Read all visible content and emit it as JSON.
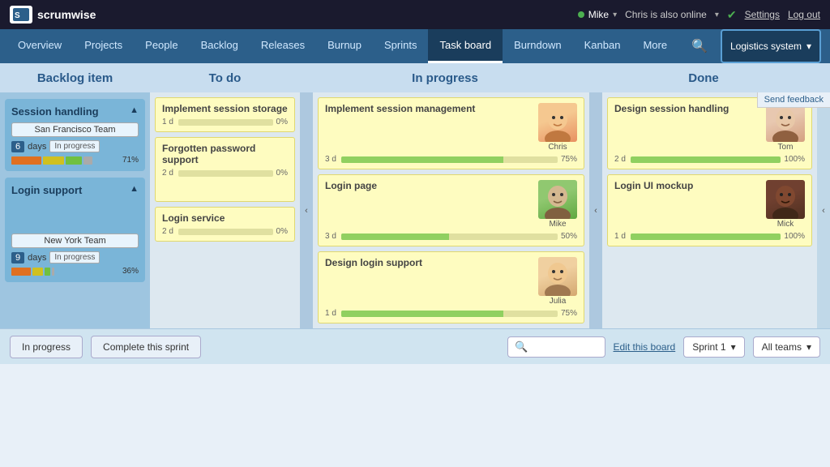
{
  "topbar": {
    "logo": "scrumwise",
    "user": "Mike",
    "online_text": "Chris is also online",
    "settings": "Settings",
    "logout": "Log out"
  },
  "nav": {
    "items": [
      {
        "label": "Overview",
        "active": false
      },
      {
        "label": "Projects",
        "active": false
      },
      {
        "label": "People",
        "active": false
      },
      {
        "label": "Backlog",
        "active": false
      },
      {
        "label": "Releases",
        "active": false
      },
      {
        "label": "Burnup",
        "active": false
      },
      {
        "label": "Sprints",
        "active": false
      },
      {
        "label": "Task board",
        "active": true
      },
      {
        "label": "Burndown",
        "active": false
      },
      {
        "label": "Kanban",
        "active": false
      },
      {
        "label": "More",
        "active": false
      }
    ],
    "system": "Logistics system",
    "send_feedback": "Send feedback"
  },
  "columns": {
    "backlog": "Backlog item",
    "todo": "To do",
    "inprogress": "In progress",
    "done": "Done"
  },
  "backlog_items": [
    {
      "title": "Session handling",
      "team": "San Francisco Team",
      "days": "6",
      "days_label": "days",
      "status": "In progress",
      "pct": "71%"
    },
    {
      "title": "Login support",
      "team": "New York Team",
      "days": "9",
      "days_label": "days",
      "status": "In progress",
      "pct": "36%"
    }
  ],
  "todo_cards": [
    {
      "title": "Implement session storage",
      "days": "1 d",
      "pct": "0%",
      "pct_fill": 0
    },
    {
      "title": "Forgotten password support",
      "days": "2 d",
      "pct": "0%",
      "pct_fill": 0
    },
    {
      "title": "Login service",
      "days": "2 d",
      "pct": "0%",
      "pct_fill": 0
    }
  ],
  "inprogress_cards": [
    {
      "title": "Implement session management",
      "days": "3 d",
      "pct": "75%",
      "pct_fill": 75,
      "person": "Chris",
      "face": "chris"
    },
    {
      "title": "Login page",
      "days": "3 d",
      "pct": "50%",
      "pct_fill": 50,
      "person": "Mike",
      "face": "mike"
    },
    {
      "title": "Design login support",
      "days": "1 d",
      "pct": "75%",
      "pct_fill": 75,
      "person": "Julia",
      "face": "julia"
    }
  ],
  "done_cards": [
    {
      "title": "Design session handling",
      "days": "2 d",
      "pct": "100%",
      "pct_fill": 100,
      "person": "Tom",
      "face": "tom"
    },
    {
      "title": "Login UI mockup",
      "days": "1 d",
      "pct": "100%",
      "pct_fill": 100,
      "person": "Mick",
      "face": "mick"
    }
  ],
  "bottom": {
    "btn_inprogress": "In progress",
    "btn_sprint": "Complete this sprint",
    "edit_board": "Edit this board",
    "sprint": "Sprint 1",
    "teams": "All teams"
  }
}
